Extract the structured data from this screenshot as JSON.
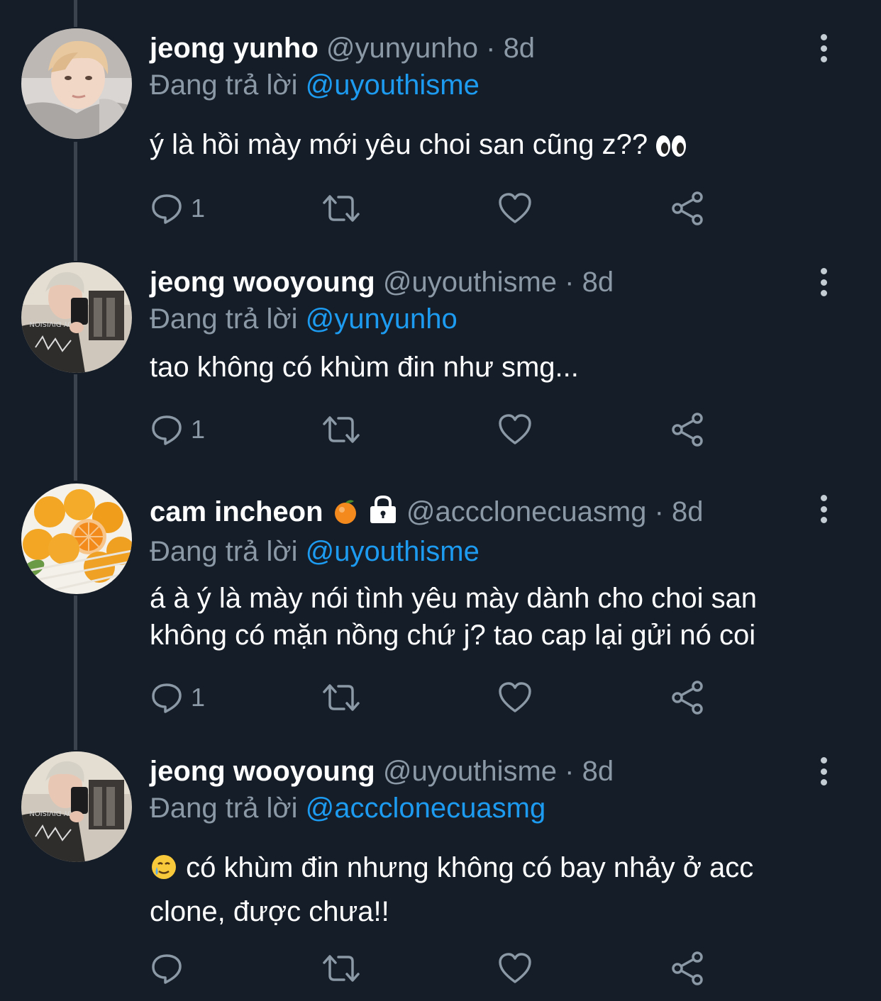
{
  "tweets": [
    {
      "name": "jeong yunho",
      "handle": "@yunyunho",
      "separator": "·",
      "time": "8d",
      "reply_label": "Đang trả lời",
      "reply_to": "@uyouthisme",
      "text": "ý là hồi mày mới yêu choi san cũng z??",
      "text_emoji": "eyes",
      "reply_count": "1",
      "avatar": "avatar-yunho"
    },
    {
      "name": "jeong wooyoung",
      "handle": "@uyouthisme",
      "separator": "·",
      "time": "8d",
      "reply_label": "Đang trả lời",
      "reply_to": "@yunyunho",
      "text": "tao không có khùm đin như smg...",
      "reply_count": "1",
      "avatar": "avatar-wooyoung",
      "shirt_text": "JOY DIVISION"
    },
    {
      "name": "cam incheon",
      "name_emoji": "tangerine",
      "protected_icon": "lock-icon",
      "handle": "@accclonecuasmg",
      "separator": "·",
      "time": "8d",
      "reply_label": "Đang trả lời",
      "reply_to": "@uyouthisme",
      "text_line1": "á à ý là mày nói tình yêu mày dành cho choi san",
      "text_line2": "không có mặn nồng chứ j? tao cap lại gửi nó coi",
      "reply_count": "1",
      "avatar": "avatar-oranges"
    },
    {
      "name": "jeong wooyoung",
      "handle": "@uyouthisme",
      "separator": "·",
      "time": "8d",
      "reply_label": "Đang trả lời",
      "reply_to": "@accclonecuasmg",
      "text_emoji": "smiling-tear",
      "text_line1": "có khùm đin nhưng không có bay nhảy ở acc",
      "text_line2": "clone, được chưa!!",
      "reply_count": "",
      "avatar": "avatar-wooyoung",
      "shirt_text": "JOY DIVISION"
    }
  ],
  "colors": {
    "background": "#151d28",
    "text_primary": "#ffffff",
    "text_secondary": "#8b98a5",
    "accent": "#1d9bf0",
    "thread_line": "#3a434e"
  },
  "icons": {
    "reply": "reply-icon",
    "retweet": "retweet-icon",
    "like": "heart-icon",
    "share": "share-icon",
    "more": "more-icon"
  }
}
